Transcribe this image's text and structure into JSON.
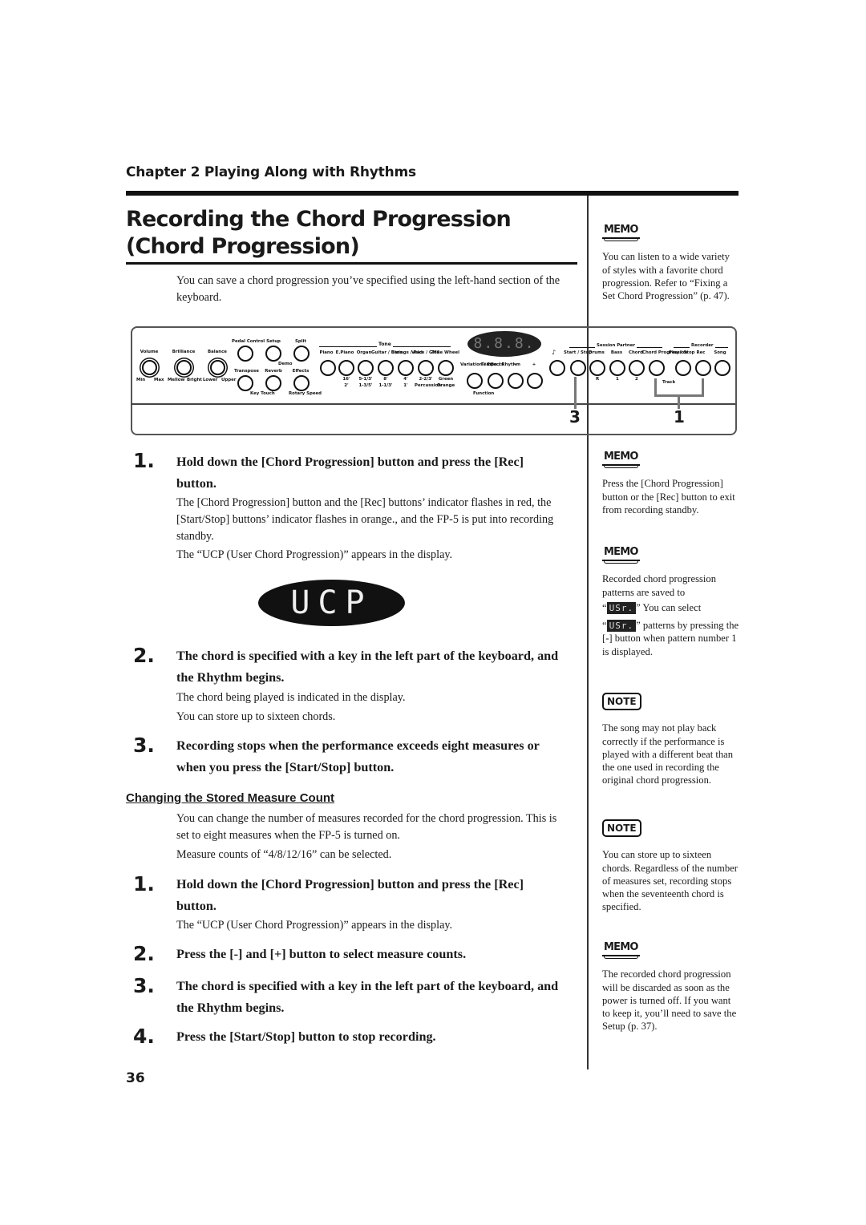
{
  "header": {
    "chapter": "Chapter 2 Playing Along with Rhythms"
  },
  "section": {
    "title_line1": "Recording the Chord Progression",
    "title_line2": "(Chord Progression)",
    "intro": "You can save a chord progression you’ve specified using the left-hand section of the keyboard."
  },
  "panel": {
    "knobs": [
      {
        "label": "Volume",
        "min": "Min",
        "max": "Max"
      },
      {
        "label": "Brilliance",
        "min": "Mellow",
        "max": "Bright"
      },
      {
        "label": "Balance",
        "min": "Lower",
        "max": "Upper"
      }
    ],
    "top_buttons": [
      "Pedal Control",
      "Setup",
      "Split"
    ],
    "demo_label": "Demo",
    "mid_buttons": [
      "Transpose",
      "Reverb",
      "Effects"
    ],
    "key_touch_label": "Key Touch",
    "rotary_label": "Rotary Speed",
    "tone_group": "Tone",
    "tone_buttons": [
      "Piano",
      "E.Piano",
      "Organ",
      "Guitar / Bass",
      "Strings / Pad",
      "Voice / GM2",
      "Tone Wheel"
    ],
    "tone_footers_top": [
      "16'",
      "5-1/3'",
      "8'",
      "4'",
      "2-2/3'",
      "Green"
    ],
    "tone_footers_bottom": [
      "2'",
      "1-3/5'",
      "1-1/3'",
      "1'",
      "Percussion",
      "Orange"
    ],
    "display": "8.8.8.",
    "var_buttons": [
      "Variation / Effects",
      "Tempo / Rhythm",
      "−",
      "+"
    ],
    "function_label": "Function",
    "session_group": "Session Partner",
    "session_buttons": [
      "Start / Stop",
      "Drums",
      "Bass",
      "Chord",
      "Chord Progression"
    ],
    "recorder_group": "Recorder",
    "recorder_buttons": [
      "Play / Stop",
      "Rec",
      "Song"
    ],
    "track_label": "Track",
    "track_numbers": [
      "R",
      "1",
      "2"
    ],
    "callout_3": "3",
    "callout_1": "1"
  },
  "steps_a": [
    {
      "num": "1.",
      "head": "Hold down the [Chord Progression] button and press the [Rec] button.",
      "body1": "The [Chord Progression] button and the [Rec] buttons’ indicator flashes in red, the [Start/Stop] buttons’ indicator flashes in orange., and the FP-5 is put into recording standby.",
      "body2": "The “UCP (User Chord Progression)” appears in the display."
    },
    {
      "num": "2.",
      "head": "The chord is specified with a key in the left part of the keyboard, and the Rhythm begins.",
      "body1": "The chord being played is indicated in the display.",
      "body2": "You can store up to sixteen chords."
    },
    {
      "num": "3.",
      "head": "Recording stops when the performance exceeds eight measures or when you press the [Start/Stop] button."
    }
  ],
  "display_ucp": "UCP",
  "subsection": {
    "title": "Changing the Stored Measure Count",
    "body1": "You can change the number of measures recorded for the chord progression. This is set to eight measures when the FP-5 is turned on.",
    "body2": "Measure counts of “4/8/12/16” can be selected."
  },
  "steps_b": [
    {
      "num": "1.",
      "head": "Hold down the [Chord Progression] button and press the [Rec] button.",
      "body": "The “UCP (User Chord Progression)” appears in the display."
    },
    {
      "num": "2.",
      "head": "Press the [-] and [+] button to select measure counts."
    },
    {
      "num": "3.",
      "head": "The chord is specified with a key in the left part of the keyboard, and the Rhythm begins."
    },
    {
      "num": "4.",
      "head": "Press the [Start/Stop] button to stop recording."
    }
  ],
  "sidebar": {
    "memo_label": "MEMO",
    "note_label": "NOTE",
    "memo1": "You can listen to a wide variety of styles with a favorite chord progression. Refer to “Fixing a Set Chord Progression” (p. 47).",
    "memo2": "Press the [Chord Progression] button or the [Rec] button to exit from recording standby.",
    "memo3_a": "Recorded chord progression patterns are saved to",
    "usr_glyph": "USr.",
    "memo3_b": "” You can select",
    "memo3_c": "” patterns by pressing the [-] button when pattern number 1 is displayed.",
    "note1": "The song may not play back correctly if the performance is played with a different beat than the one used in recording the original chord progression.",
    "note2": "You can store up to sixteen chords. Regardless of the number of measures set, recording stops when the seventeenth chord is specified.",
    "memo4": "The recorded chord progression will be discarded as soon as the power is turned off. If you want to keep it, you’ll need to save the Setup (p. 37)."
  },
  "footer": {
    "page_number": "36"
  }
}
